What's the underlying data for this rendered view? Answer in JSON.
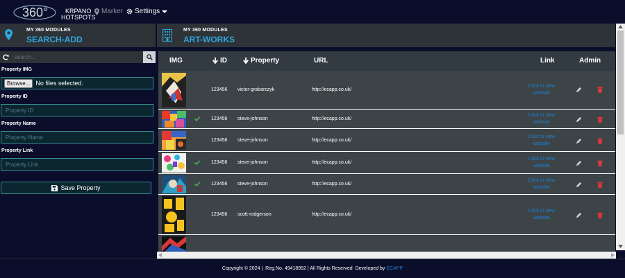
{
  "nav": {
    "logo_number": "360°",
    "logo_line1": "KRPANO",
    "logo_line2": "HOTSPOTS",
    "marker": "Marker",
    "settings": "Settings"
  },
  "left": {
    "header_small": "MY 360 MODULES",
    "header_big": "SEARCH-ADD",
    "search_placeholder": "search...",
    "img_label": "Property IMG",
    "browse": "Browse...",
    "no_file": "No files selected.",
    "id_label": "Property ID",
    "id_placeholder": "Property ID",
    "name_label": "Property Name",
    "name_placeholder": "Property Name",
    "link_label": "Property Link",
    "link_placeholder": "Property Link",
    "save": "Save Property"
  },
  "right": {
    "header_small": "MY 360 MODULES",
    "header_big": "ART-WORKS",
    "columns": {
      "img": "IMG",
      "id": "ID",
      "property": "Property",
      "url": "URL",
      "link": "Link",
      "admin": "Admin"
    },
    "rows": [
      {
        "id": "123456",
        "property": "victor-grabarczyk",
        "url": "http://ecapp.co.uk/",
        "link": "Click to view website",
        "checked": false
      },
      {
        "id": "123456",
        "property": "steve-johnson",
        "url": "http://ecapp.co.uk/",
        "link": "Click to view website",
        "checked": true
      },
      {
        "id": "123456",
        "property": "steve-johnson",
        "url": "http://ecapp.co.uk/",
        "link": "Click to view website",
        "checked": false
      },
      {
        "id": "123456",
        "property": "steve-johnson",
        "url": "http://ecapp.co.uk/",
        "link": "Click to view website",
        "checked": true
      },
      {
        "id": "123456",
        "property": "steve-johnson",
        "url": "http://ecapp.co.uk/",
        "link": "Click to view website",
        "checked": true
      },
      {
        "id": "123456",
        "property": "scott-rodgerson",
        "url": "http://ecapp.co.uk/",
        "link": "Click to view website",
        "checked": false
      }
    ]
  },
  "footer": {
    "text": "Copyright © 2024 |  Reg.No. 49418952 | All Rights Reserved  Developed by ",
    "brand": "ECAPP"
  },
  "colors": {
    "accent": "#2fa6de",
    "background": "#0a0e2b",
    "panel": "#2e3338",
    "row": "#3d4448",
    "link": "#1f7fd0",
    "delete": "#d9383a",
    "check": "#4caf50"
  }
}
